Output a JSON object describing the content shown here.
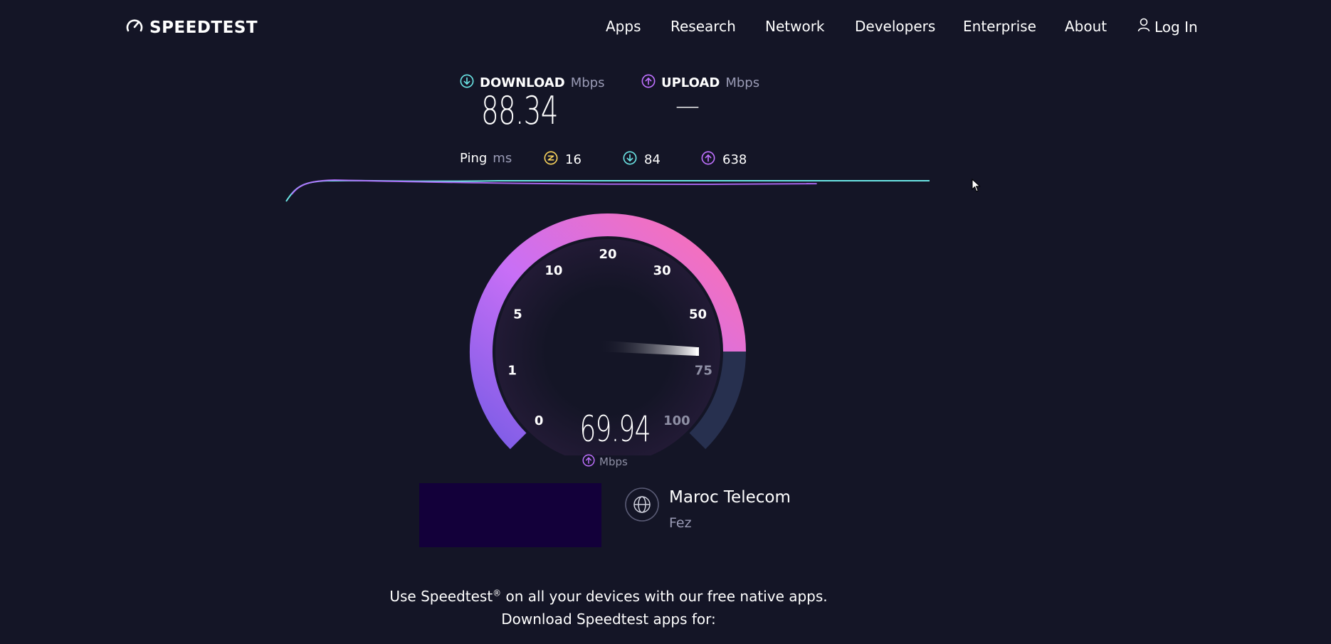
{
  "header": {
    "logo_text": "SPEEDTEST",
    "nav": [
      {
        "label": "Apps"
      },
      {
        "label": "Research"
      },
      {
        "label": "Network"
      },
      {
        "label": "Developers"
      },
      {
        "label": "Enterprise"
      },
      {
        "label": "About"
      }
    ],
    "login_label": "Log In"
  },
  "results": {
    "download": {
      "label": "DOWNLOAD",
      "unit": "Mbps",
      "value": "88.34"
    },
    "upload": {
      "label": "UPLOAD",
      "unit": "Mbps",
      "value": "—"
    },
    "ping": {
      "label": "Ping",
      "unit": "ms",
      "idle": "16",
      "download": "84",
      "upload": "638"
    }
  },
  "gauge": {
    "ticks": [
      "0",
      "1",
      "5",
      "10",
      "20",
      "30",
      "50",
      "75",
      "100"
    ],
    "current_value": "69.94",
    "unit": "Mbps",
    "colors": {
      "start": "#7b5ce6",
      "end": "#ff70b0",
      "track": "#27304f"
    }
  },
  "server": {
    "provider": "Maroc Telecom",
    "location": "Fez"
  },
  "footer": {
    "line1_a": "Use Speedtest",
    "line1_sup": "®",
    "line1_b": " on all your devices with our free native apps.",
    "line2": "Download Speedtest apps for:"
  }
}
